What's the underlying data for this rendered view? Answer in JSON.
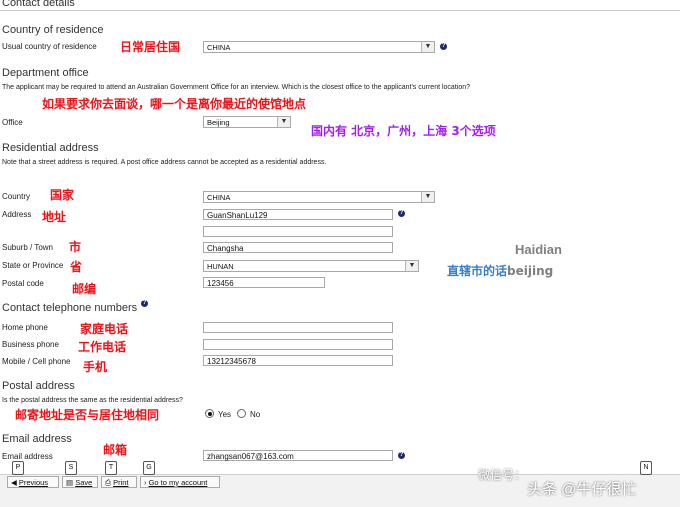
{
  "header": {
    "title": "Contact details"
  },
  "country_of_residence": {
    "section": "Country of residence",
    "label": "Usual country of residence",
    "value": "CHINA",
    "note_cn": "日常居住国"
  },
  "department_office": {
    "section": "Department office",
    "description": "The applicant may be required to attend an Australian Government Office for an interview. Which is the closest office to the applicant's current location?",
    "note_cn": "如果要求你去面谈，哪一个是离你最近的使馆地点",
    "label": "Office",
    "value": "Beijing",
    "options_note_cn": "国内有 北京，广州，上海 3个选项"
  },
  "residential_address": {
    "section": "Residential address",
    "description": "Note that a street address is required. A post office address cannot be accepted as a residential address.",
    "country_label": "Country",
    "country_value": "CHINA",
    "country_note_cn": "国家",
    "address_label": "Address",
    "address_line1": "GuanShanLu129",
    "address_line2": "",
    "address_note_cn": "地址",
    "suburb_label": "Suburb / Town",
    "suburb_value": "Changsha",
    "suburb_note_cn": "市",
    "state_label": "State or Province",
    "state_value": "HUNAN",
    "state_note_cn": "省",
    "postcode_label": "Postal code",
    "postcode_value": "123456",
    "postcode_note_cn": "邮编",
    "haidian_note": "Haidian",
    "municipality_note_cn": "直辖市的话",
    "municipality_note_en": "beijing"
  },
  "contact_telephone": {
    "section": "Contact telephone numbers",
    "home_label": "Home phone",
    "home_value": "",
    "home_note_cn": "家庭电话",
    "business_label": "Business phone",
    "business_value": "",
    "business_note_cn": "工作电话",
    "mobile_label": "Mobile / Cell phone",
    "mobile_value": "13212345678",
    "mobile_note_cn": "手机"
  },
  "postal_address": {
    "section": "Postal address",
    "question": "Is the postal address the same as the residential address?",
    "yes_label": "Yes",
    "no_label": "No",
    "selected": "Yes",
    "note_cn": "邮寄地址是否与居住地相同"
  },
  "email_address": {
    "section": "Email address",
    "label": "Email address",
    "value": "zhangsan067@163.com",
    "note_cn": "邮箱"
  },
  "toolbar": {
    "previous_label": "Previous",
    "save_label": "Save",
    "print_label": "Print",
    "goto_label": "Go to my account",
    "previous_key": "P",
    "save_key": "S",
    "print_key": "T",
    "goto_key": "G",
    "next_key": "N"
  },
  "watermark": {
    "text": "头条 @牛仔很忙",
    "wechat": "微信号："
  },
  "colors": {
    "annotation_red": "#e8151b",
    "annotation_purple": "#a020f0",
    "annotation_blue": "#3b7fc4",
    "help_icon": "#1c2a6b"
  }
}
